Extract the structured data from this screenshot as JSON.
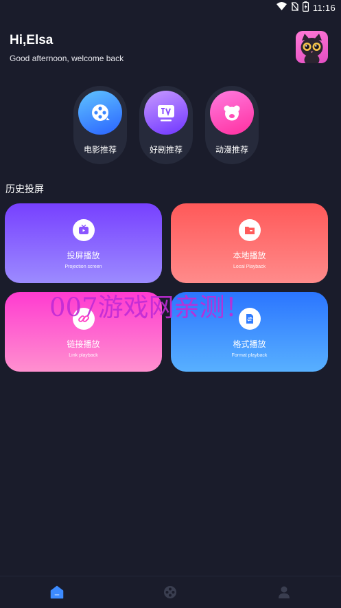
{
  "status_bar": {
    "time": "11:16",
    "icons": [
      "wifi-icon",
      "no-sim-icon",
      "battery-charging-icon"
    ]
  },
  "header": {
    "greeting": "Hi,Elsa",
    "subtitle": "Good afternoon, welcome back",
    "avatar_icon": "cat-avatar-icon"
  },
  "categories": [
    {
      "label": "电影推荐",
      "icon": "film-reel-icon",
      "color_from": "#4fb6ff",
      "color_to": "#2b6dff"
    },
    {
      "label": "好剧推荐",
      "icon": "tv-icon",
      "color_from": "#c08bff",
      "color_to": "#7b3dff"
    },
    {
      "label": "动漫推荐",
      "icon": "bear-icon",
      "color_from": "#ff6fd8",
      "color_to": "#ff2aa7"
    }
  ],
  "history_title": "历史投屏",
  "cards": [
    {
      "title": "投屏播放",
      "subtitle": "Projection screen",
      "icon": "cast-tv-icon",
      "color_from": "#7a42ff",
      "color_to": "#9b8bff"
    },
    {
      "title": "本地播放",
      "subtitle": "Local Playback",
      "icon": "folder-icon",
      "color_from": "#ff5a5a",
      "color_to": "#ff8a8a"
    },
    {
      "title": "链接播放",
      "subtitle": "Link playback",
      "icon": "link-icon",
      "color_from": "#ff3fd0",
      "color_to": "#ff8fcf"
    },
    {
      "title": "格式播放",
      "subtitle": "Format playback",
      "icon": "file-convert-icon",
      "color_from": "#2c77ff",
      "color_to": "#5ab1ff"
    }
  ],
  "watermark": "007游戏网亲测！",
  "bottom_nav": [
    {
      "icon": "home-icon",
      "active": true
    },
    {
      "icon": "film-reel-icon",
      "active": false
    },
    {
      "icon": "user-icon",
      "active": false
    }
  ],
  "colors": {
    "background": "#1a1c2b",
    "pill_background": "#262a3b",
    "nav_active": "#3d8bff",
    "nav_inactive": "#3a3e50"
  }
}
